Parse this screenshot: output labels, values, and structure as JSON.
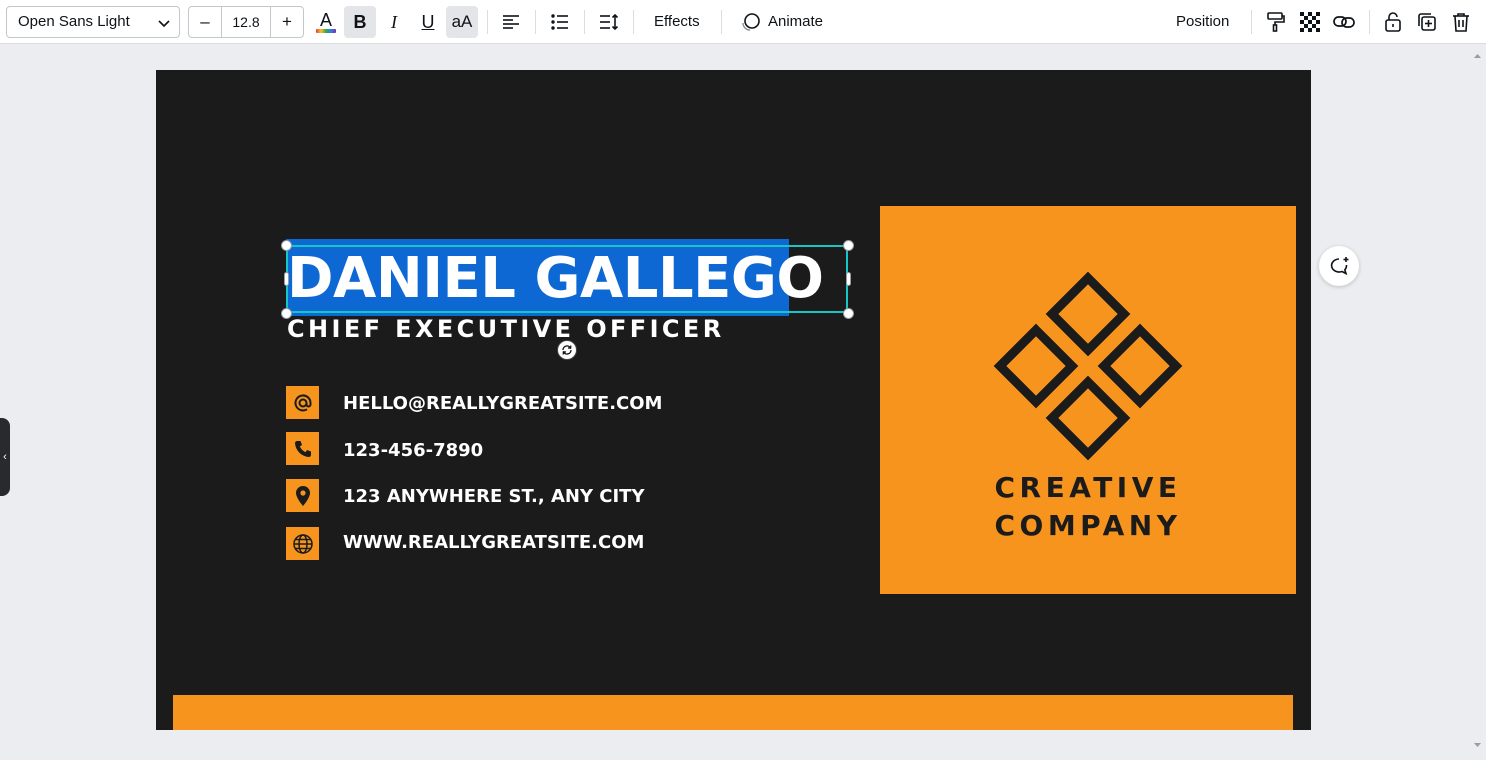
{
  "toolbar": {
    "font_family": "Open Sans Light",
    "font_size": "12.8",
    "decrease_label": "–",
    "increase_label": "+",
    "text_color_label": "A",
    "bold_label": "B",
    "italic_label": "I",
    "underline_label": "U",
    "case_label": "aA",
    "effects_label": "Effects",
    "animate_label": "Animate",
    "position_label": "Position",
    "icons": [
      "chevron-down-icon",
      "text-color-icon",
      "align-left-icon",
      "bullet-list-icon",
      "line-spacing-icon",
      "animate-icon",
      "paint-format-icon",
      "transparency-icon",
      "link-icon",
      "lock-icon",
      "duplicate-icon",
      "trash-icon"
    ]
  },
  "card": {
    "name": "DANIEL GALLEGO",
    "job_title": "CHIEF EXECUTIVE OFFICER",
    "contacts": [
      {
        "icon": "at-icon",
        "text": "HELLO@REALLYGREATSITE.COM"
      },
      {
        "icon": "phone-icon",
        "text": "123-456-7890"
      },
      {
        "icon": "location-pin-icon",
        "text": "123 ANYWHERE ST., ANY CITY"
      },
      {
        "icon": "globe-icon",
        "text": "WWW.REALLYGREATSITE.COM"
      }
    ],
    "company_line1": "CREATIVE",
    "company_line2": "COMPANY"
  },
  "colors": {
    "card_bg": "#1b1b1b",
    "accent": "#f7941d",
    "selection_highlight": "#0d68d4",
    "selection_border": "#16c6c4"
  }
}
